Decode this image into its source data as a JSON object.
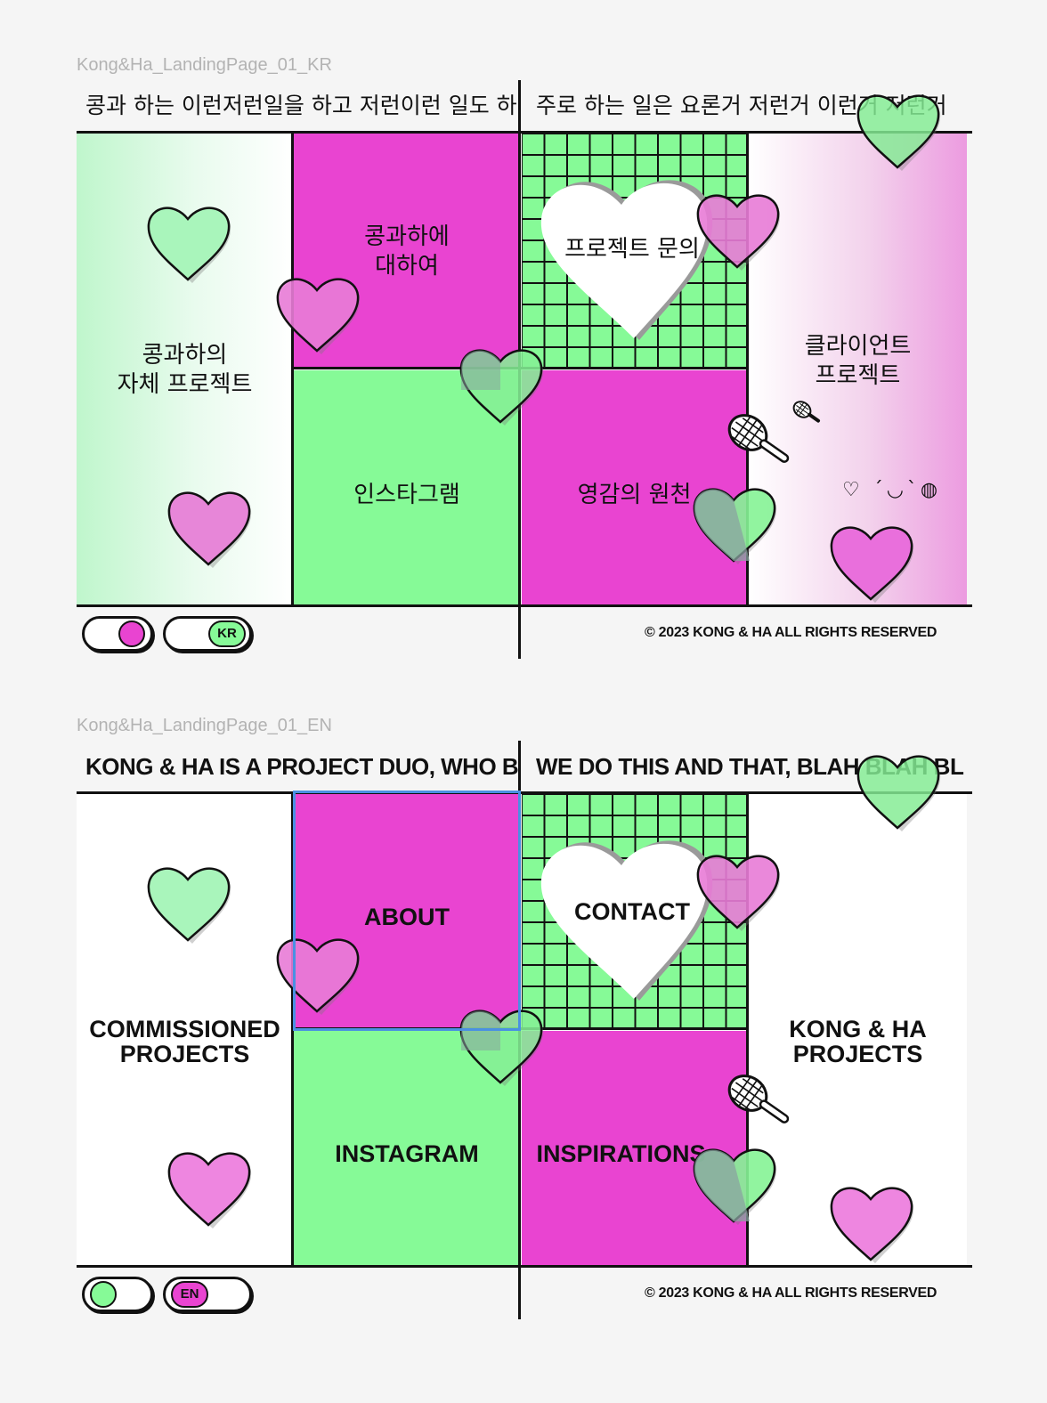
{
  "frames": [
    {
      "label": "Kong&Ha_LandingPage_01_KR",
      "marquee_left": "콩과 하는 이런저런일을 하고 저런이런 일도 하",
      "marquee_right": "주로 하는 일은 요론거 저런거 이런거 저런거",
      "cells": {
        "self_projects": "콩과하의\n자체 프로젝트",
        "about": "콩과하에\n대하여",
        "contact": "프로젝트 문의",
        "client_projects": "클라이언트\n프로젝트",
        "instagram": "인스타그램",
        "inspirations": "영감의 원천"
      },
      "emoticon": "♡ ˊ◡ˋ◍",
      "lang_label": "KR",
      "copyright": "© 2023 KONG & HA ALL RIGHTS RESERVED"
    },
    {
      "label": "Kong&Ha_LandingPage_01_EN",
      "marquee_left": "KONG & HA IS A PROJECT DUO, WHO BL",
      "marquee_right": "WE DO THIS AND THAT, BLAH BLAH BL",
      "cells": {
        "self_projects": "COMMISSIONED\nPROJECTS",
        "about": "ABOUT",
        "contact": "CONTACT",
        "client_projects": "KONG & HA\nPROJECTS",
        "instagram": "INSTAGRAM",
        "inspirations": "INSPIRATIONS"
      },
      "lang_label": "EN",
      "copyright": "© 2023 KONG & HA ALL RIGHTS RESERVED"
    }
  ],
  "colors": {
    "magenta": "#e944d1",
    "green": "#86fa97",
    "black": "#111111",
    "selection": "#4a90e2"
  },
  "icons": [
    "heart-icon",
    "tennis-racket-icon"
  ]
}
